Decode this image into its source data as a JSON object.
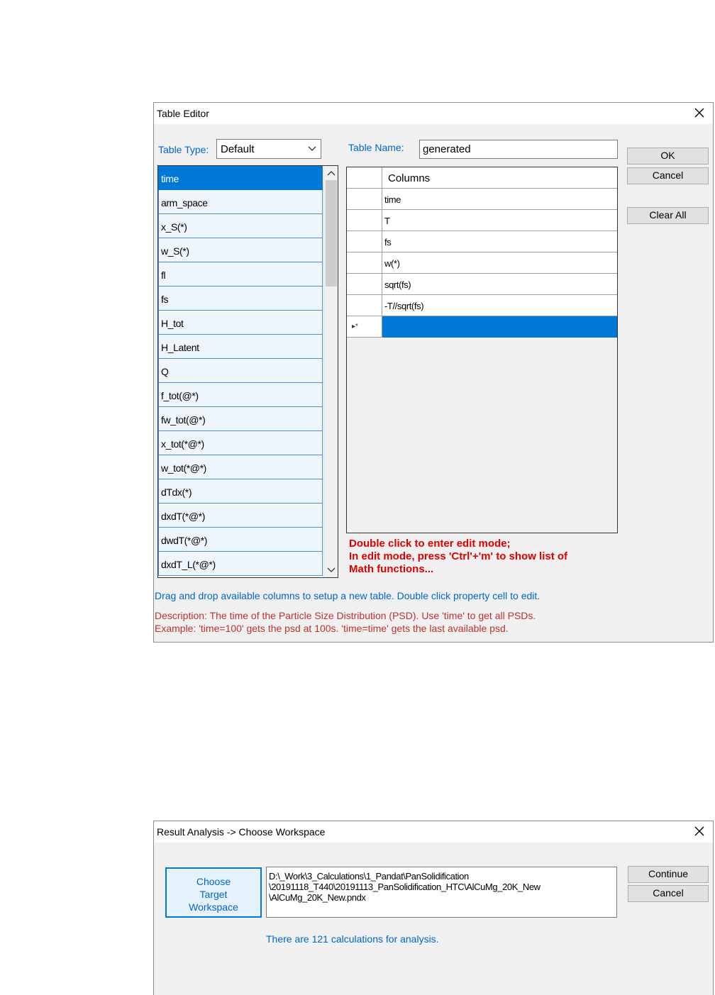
{
  "table_editor": {
    "title": "Table Editor",
    "table_type_label": "Table Type:",
    "table_type_value": "Default",
    "table_name_label": "Table Name:",
    "table_name_value": "generated",
    "buttons": {
      "ok": "OK",
      "cancel": "Cancel",
      "clear_all": "Clear All"
    },
    "available_columns": [
      "time",
      "arm_space",
      "x_S(*)",
      "w_S(*)",
      "fl",
      "fs",
      "H_tot",
      "H_Latent",
      "Q",
      "f_tot(@*)",
      "fw_tot(@*)",
      "x_tot(*@*)",
      "w_tot(*@*)",
      "dTdx(*)",
      "dxdT(*@*)",
      "dwdT(*@*)",
      "dxdT_L(*@*)"
    ],
    "selected_available": "time",
    "grid_header": "Columns",
    "grid_rows": [
      "time",
      "T",
      "fs",
      "w(*)",
      "sqrt(fs)",
      "-T//sqrt(fs)"
    ],
    "new_row_marker": "▸*",
    "edit_note": [
      "Double click to enter edit mode;",
      "In edit mode, press 'Ctrl'+'m' to show list of",
      "Math functions..."
    ],
    "hint": "Drag and drop available columns to setup a new table. Double click property cell to edit.",
    "description": "Description: The time of the Particle Size Distribution (PSD). Use 'time' to get all PSDs.",
    "example": "Example: 'time=100' gets the psd at 100s. 'time=time' gets the last available psd."
  },
  "choose_workspace": {
    "title": "Result Analysis -> Choose Workspace",
    "choose_button": [
      "Choose",
      "Target",
      "Workspace"
    ],
    "path_lines": [
      "D:\\_Work\\3_Calculations\\1_Pandat\\PanSolidification",
      "\\20191118_T440\\20191113_PanSolidification_HTC\\AlCuMg_20K_New",
      "\\AlCuMg_20K_New.pndx"
    ],
    "info": "There are 121 calculations for analysis.",
    "buttons": {
      "continue": "Continue",
      "cancel": "Cancel"
    }
  },
  "icons": {
    "close": "close-icon",
    "dropdown": "chevron-down-icon"
  },
  "colors": {
    "selection": "#0078d7",
    "link_blue": "#0066cc",
    "note_red": "#e00000"
  }
}
